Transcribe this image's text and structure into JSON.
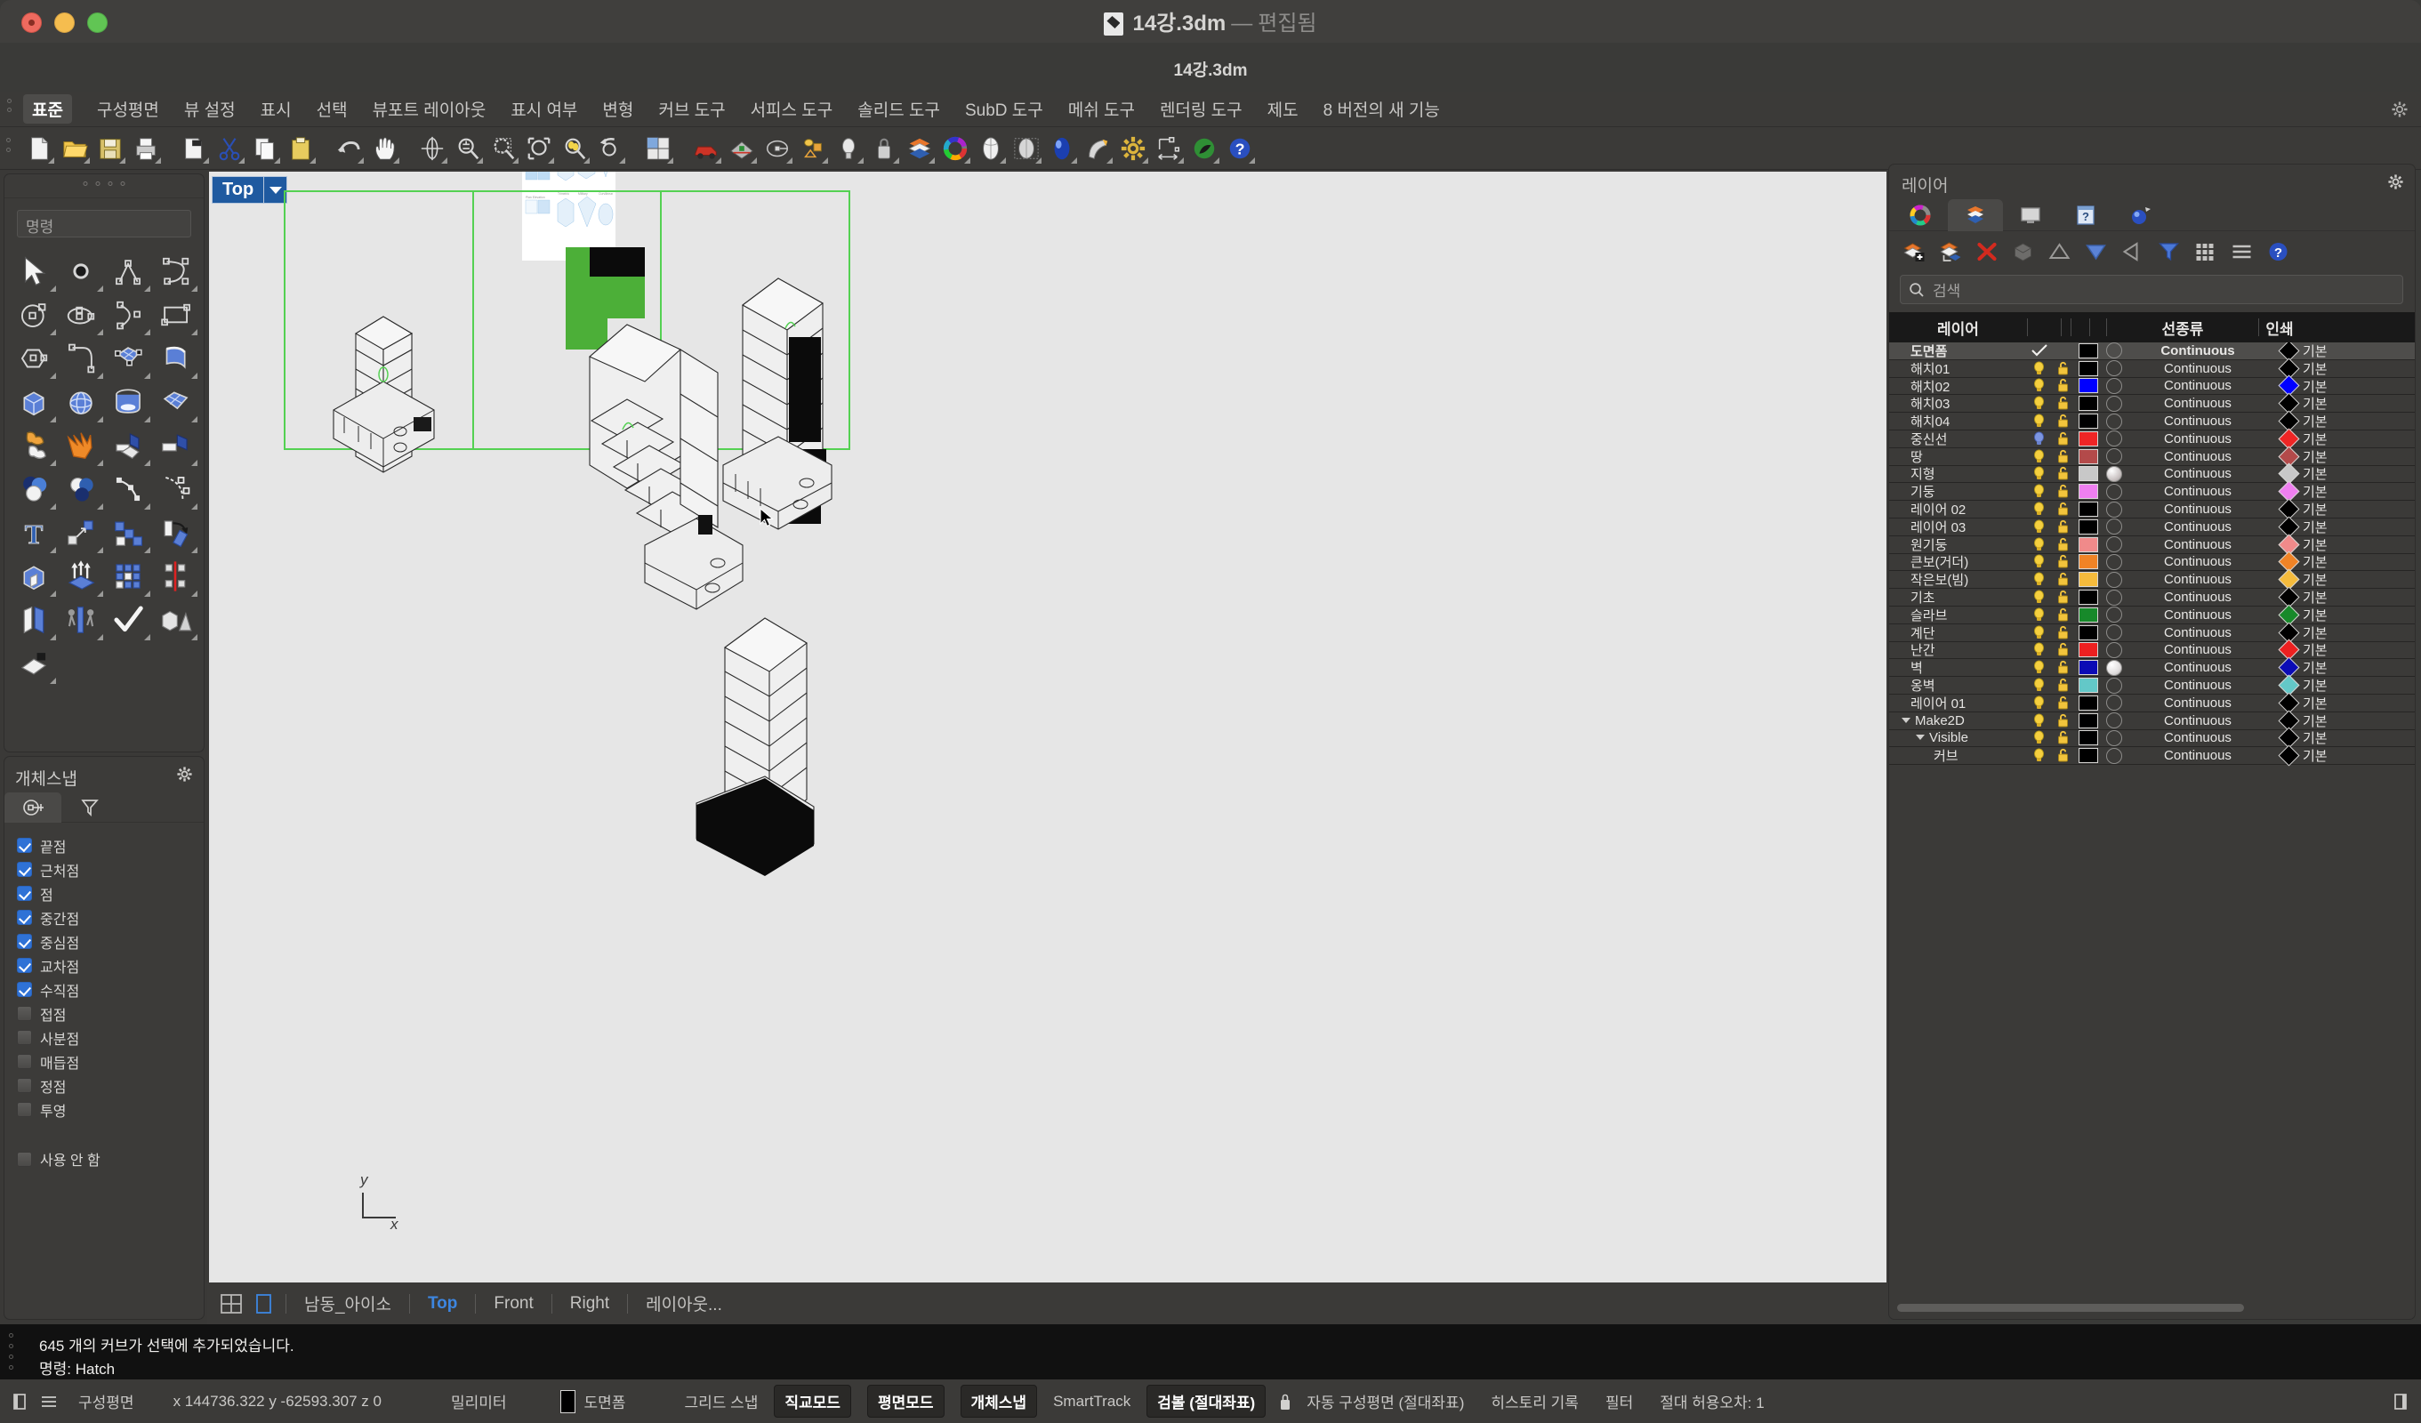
{
  "window": {
    "title": "14강.3dm",
    "title_dash": "—",
    "title_state": "편집됨",
    "subtitle": "14강.3dm",
    "doc_icon": "rhino-document-icon"
  },
  "menubar": {
    "items": [
      {
        "label": "표준",
        "active": true
      },
      {
        "label": "구성평면",
        "active": false
      },
      {
        "label": "뷰 설정",
        "active": false
      },
      {
        "label": "표시",
        "active": false
      },
      {
        "label": "선택",
        "active": false
      },
      {
        "label": "뷰포트 레이아웃",
        "active": false
      },
      {
        "label": "표시 여부",
        "active": false
      },
      {
        "label": "변형",
        "active": false
      },
      {
        "label": "커브 도구",
        "active": false
      },
      {
        "label": "서피스 도구",
        "active": false
      },
      {
        "label": "솔리드 도구",
        "active": false
      },
      {
        "label": "SubD 도구",
        "active": false
      },
      {
        "label": "메쉬 도구",
        "active": false
      },
      {
        "label": "렌더링 도구",
        "active": false
      },
      {
        "label": "제도",
        "active": false
      },
      {
        "label": "8 버전의 새 기능",
        "active": false
      }
    ],
    "settings_icon": "gear-icon"
  },
  "toolbar": {
    "buttons": [
      {
        "name": "new-file-icon"
      },
      {
        "name": "open-file-icon"
      },
      {
        "name": "save-file-icon"
      },
      {
        "name": "print-icon"
      },
      {
        "name": "copy-to-clipboard-icon"
      },
      {
        "name": "cut-icon"
      },
      {
        "name": "copy-icon"
      },
      {
        "name": "paste-icon"
      },
      {
        "name": "undo-icon"
      },
      {
        "name": "pan-icon"
      },
      {
        "name": "rotate-view-icon"
      },
      {
        "name": "zoom-icon"
      },
      {
        "name": "zoom-window-icon"
      },
      {
        "name": "zoom-extents-icon"
      },
      {
        "name": "zoom-selected-icon"
      },
      {
        "name": "undo-view-icon"
      },
      {
        "name": "four-viewport-icon"
      },
      {
        "name": "car-render-icon"
      },
      {
        "name": "grid-icon"
      },
      {
        "name": "point-object-icon"
      },
      {
        "name": "layer-state-icon"
      },
      {
        "name": "light-bulb-icon"
      },
      {
        "name": "lock-icon"
      },
      {
        "name": "layer-icon"
      },
      {
        "name": "color-wheel-icon"
      },
      {
        "name": "shaded-view-icon"
      },
      {
        "name": "ghosted-view-icon"
      },
      {
        "name": "render-preview-icon"
      },
      {
        "name": "spotlight-icon"
      },
      {
        "name": "options-gear-icon"
      },
      {
        "name": "dimension-icon"
      },
      {
        "name": "render-icon"
      },
      {
        "name": "help-icon"
      }
    ]
  },
  "left_panel": {
    "command_placeholder": "명령",
    "tools": [
      {
        "name": "select-arrow-icon"
      },
      {
        "name": "point-icon"
      },
      {
        "name": "polyline-icon"
      },
      {
        "name": "curve-icon"
      },
      {
        "name": "circle-icon"
      },
      {
        "name": "ellipse-icon"
      },
      {
        "name": "arc-icon"
      },
      {
        "name": "rectangle-icon"
      },
      {
        "name": "polygon-icon"
      },
      {
        "name": "fillet-curve-icon"
      },
      {
        "name": "surface-from-curves-icon"
      },
      {
        "name": "extrude-surface-icon"
      },
      {
        "name": "box-icon"
      },
      {
        "name": "sphere-icon"
      },
      {
        "name": "cylinder-icon"
      },
      {
        "name": "surface-patch-icon"
      },
      {
        "name": "boolean-union-icon"
      },
      {
        "name": "explode-icon"
      },
      {
        "name": "fillet-edge-icon"
      },
      {
        "name": "chamfer-edge-icon"
      },
      {
        "name": "boolean-difference-icon"
      },
      {
        "name": "boolean-split-icon"
      },
      {
        "name": "rebuild-curve-icon"
      },
      {
        "name": "curve-points-icon"
      },
      {
        "name": "text-icon"
      },
      {
        "name": "move-icon"
      },
      {
        "name": "copy-objects-icon"
      },
      {
        "name": "rotate-icon"
      },
      {
        "name": "cap-solid-icon"
      },
      {
        "name": "extrude-icon"
      },
      {
        "name": "array-icon"
      },
      {
        "name": "mirror-icon"
      },
      {
        "name": "split-icon"
      },
      {
        "name": "scale-icon"
      },
      {
        "name": "check-object-icon"
      },
      {
        "name": "group-objects-icon"
      },
      {
        "name": "cplane-icon"
      }
    ]
  },
  "osnap": {
    "title": "개체스냅",
    "gear_icon": "gear-icon",
    "tabs": [
      {
        "name": "osnap-tab-icon",
        "selected": true
      },
      {
        "name": "filter-tab-icon",
        "selected": false
      }
    ],
    "items": [
      {
        "label": "끝점",
        "checked": true
      },
      {
        "label": "근처점",
        "checked": true
      },
      {
        "label": "점",
        "checked": true
      },
      {
        "label": "중간점",
        "checked": true
      },
      {
        "label": "중심점",
        "checked": true
      },
      {
        "label": "교차점",
        "checked": true
      },
      {
        "label": "수직점",
        "checked": true
      },
      {
        "label": "접점",
        "checked": false
      },
      {
        "label": "사분점",
        "checked": false
      },
      {
        "label": "매듭점",
        "checked": false
      },
      {
        "label": "정점",
        "checked": false
      },
      {
        "label": "투영",
        "checked": false
      }
    ],
    "disable": {
      "label": "사용 안 함",
      "checked": false
    }
  },
  "viewport": {
    "label": "Top",
    "dropdown_icon": "chevron-down-icon",
    "axis_x": "x",
    "axis_y": "y",
    "tabs": [
      {
        "label": "남동_아이소",
        "active": false
      },
      {
        "label": "Top",
        "active": true
      },
      {
        "label": "Front",
        "active": false
      },
      {
        "label": "Right",
        "active": false
      },
      {
        "label": "레이아웃...",
        "active": false
      }
    ],
    "tab_icons": [
      {
        "name": "four-view-layout-icon"
      },
      {
        "name": "single-view-layout-icon"
      }
    ]
  },
  "layers_panel": {
    "title": "레이어",
    "gear_icon": "gear-icon",
    "tabs": [
      {
        "name": "properties-tab-icon",
        "selected": false
      },
      {
        "name": "layers-tab-icon",
        "selected": true
      },
      {
        "name": "display-tab-icon",
        "selected": false
      },
      {
        "name": "help-tab-icon",
        "selected": false
      },
      {
        "name": "render-tab-icon",
        "selected": false
      }
    ],
    "tools": [
      {
        "name": "new-layer-icon"
      },
      {
        "name": "new-sublayer-icon"
      },
      {
        "name": "delete-layer-icon"
      },
      {
        "name": "select-objects-icon"
      },
      {
        "name": "move-up-icon"
      },
      {
        "name": "move-down-icon"
      },
      {
        "name": "move-left-icon"
      },
      {
        "name": "filter-icon"
      },
      {
        "name": "grid-view-icon"
      },
      {
        "name": "list-view-icon"
      },
      {
        "name": "help-icon"
      }
    ],
    "search_placeholder": "검색",
    "columns": {
      "name": "레이어",
      "linetype": "선종류",
      "print": "인쇄"
    },
    "default_linetype": "Continuous",
    "default_print": "기본",
    "rows": [
      {
        "name": "도면폼",
        "indent": 0,
        "current": true,
        "visible": true,
        "locked": false,
        "color": "#000000",
        "material": "none",
        "linetype": "Continuous",
        "print": "기본",
        "print_color": "#000000"
      },
      {
        "name": "해치01",
        "indent": 0,
        "current": false,
        "visible": true,
        "locked": false,
        "color": "#000000",
        "material": "none",
        "linetype": "Continuous",
        "print": "기본",
        "print_color": "#000000"
      },
      {
        "name": "해치02",
        "indent": 0,
        "current": false,
        "visible": true,
        "locked": false,
        "color": "#0000ff",
        "material": "none",
        "linetype": "Continuous",
        "print": "기본",
        "print_color": "#0000ff"
      },
      {
        "name": "해치03",
        "indent": 0,
        "current": false,
        "visible": true,
        "locked": false,
        "color": "#000000",
        "material": "none",
        "linetype": "Continuous",
        "print": "기본",
        "print_color": "#000000"
      },
      {
        "name": "해치04",
        "indent": 0,
        "current": false,
        "visible": true,
        "locked": false,
        "color": "#000000",
        "material": "none",
        "linetype": "Continuous",
        "print": "기본",
        "print_color": "#000000"
      },
      {
        "name": "중신선",
        "indent": 0,
        "current": false,
        "visible": true,
        "locked": false,
        "color": "#ef2525",
        "material": "none",
        "linetype": "Continuous",
        "print": "기본",
        "print_color": "#ef2525",
        "bulb": "blue"
      },
      {
        "name": "땅",
        "indent": 0,
        "current": false,
        "visible": true,
        "locked": false,
        "color": "#b34a4a",
        "material": "none",
        "linetype": "Continuous",
        "print": "기본",
        "print_color": "#b34a4a"
      },
      {
        "name": "지형",
        "indent": 0,
        "current": false,
        "visible": true,
        "locked": false,
        "color": "#c8c8c8",
        "material": "filled",
        "linetype": "Continuous",
        "print": "기본",
        "print_color": "#c8c8c8"
      },
      {
        "name": "기둥",
        "indent": 0,
        "current": false,
        "visible": true,
        "locked": false,
        "color": "#ef7ff0",
        "material": "none",
        "linetype": "Continuous",
        "print": "기본",
        "print_color": "#ef7ff0"
      },
      {
        "name": "레이어 02",
        "indent": 0,
        "current": false,
        "visible": true,
        "locked": false,
        "color": "#000000",
        "material": "none",
        "linetype": "Continuous",
        "print": "기본",
        "print_color": "#000000"
      },
      {
        "name": "레이어 03",
        "indent": 0,
        "current": false,
        "visible": true,
        "locked": false,
        "color": "#000000",
        "material": "none",
        "linetype": "Continuous",
        "print": "기본",
        "print_color": "#000000"
      },
      {
        "name": "원기둥",
        "indent": 0,
        "current": false,
        "visible": true,
        "locked": false,
        "color": "#f08a8a",
        "material": "none",
        "linetype": "Continuous",
        "print": "기본",
        "print_color": "#f08a8a"
      },
      {
        "name": "큰보(거더)",
        "indent": 0,
        "current": false,
        "visible": true,
        "locked": false,
        "color": "#f08326",
        "material": "none",
        "linetype": "Continuous",
        "print": "기본",
        "print_color": "#f08326"
      },
      {
        "name": "작은보(빔)",
        "indent": 0,
        "current": false,
        "visible": true,
        "locked": false,
        "color": "#f5bb3c",
        "material": "none",
        "linetype": "Continuous",
        "print": "기본",
        "print_color": "#f5bb3c"
      },
      {
        "name": "기초",
        "indent": 0,
        "current": false,
        "visible": true,
        "locked": false,
        "color": "#000000",
        "material": "none",
        "linetype": "Continuous",
        "print": "기본",
        "print_color": "#000000"
      },
      {
        "name": "슬라브",
        "indent": 0,
        "current": false,
        "visible": true,
        "locked": false,
        "color": "#17892a",
        "material": "none",
        "linetype": "Continuous",
        "print": "기본",
        "print_color": "#17892a"
      },
      {
        "name": "계단",
        "indent": 0,
        "current": false,
        "visible": true,
        "locked": false,
        "color": "#000000",
        "material": "none",
        "linetype": "Continuous",
        "print": "기본",
        "print_color": "#000000"
      },
      {
        "name": "난간",
        "indent": 0,
        "current": false,
        "visible": true,
        "locked": false,
        "color": "#ee2020",
        "material": "none",
        "linetype": "Continuous",
        "print": "기본",
        "print_color": "#ee2020"
      },
      {
        "name": "벽",
        "indent": 0,
        "current": false,
        "visible": true,
        "locked": false,
        "color": "#0b0bb5",
        "material": "white",
        "linetype": "Continuous",
        "print": "기본",
        "print_color": "#0b0bb5"
      },
      {
        "name": "옹벽",
        "indent": 0,
        "current": false,
        "visible": true,
        "locked": false,
        "color": "#63c8c8",
        "material": "none",
        "linetype": "Continuous",
        "print": "기본",
        "print_color": "#63c8c8"
      },
      {
        "name": "레이어 01",
        "indent": 0,
        "current": false,
        "visible": true,
        "locked": false,
        "color": "#000000",
        "material": "none",
        "linetype": "Continuous",
        "print": "기본",
        "print_color": "#000000"
      },
      {
        "name": "Make2D",
        "indent": 0,
        "expander": true,
        "current": false,
        "visible": true,
        "locked": false,
        "color": "#000000",
        "material": "none",
        "linetype": "Continuous",
        "print": "기본",
        "print_color": "#000000"
      },
      {
        "name": "Visible",
        "indent": 1,
        "expander": true,
        "current": false,
        "visible": true,
        "locked": false,
        "color": "#000000",
        "material": "none",
        "linetype": "Continuous",
        "print": "기본",
        "print_color": "#000000"
      },
      {
        "name": "커브",
        "indent": 2,
        "current": false,
        "visible": true,
        "locked": false,
        "color": "#000000",
        "material": "none",
        "linetype": "Continuous",
        "print": "기본",
        "print_color": "#000000"
      }
    ]
  },
  "command_history": {
    "line1": "645 개의 커브가 선택에 추가되었습니다.",
    "line2": "명령: Hatch"
  },
  "statusbar": {
    "cplane_label": "구성평면",
    "coords": "x 144736.322  y -62593.307  z 0",
    "units": "밀리미터",
    "layer_label": "도면폼",
    "layer_color": "#000000",
    "items": [
      {
        "label": "그리드 스냅",
        "on": false
      },
      {
        "label": "직교모드",
        "on": true
      },
      {
        "label": "평면모드",
        "on": true
      },
      {
        "label": "개체스냅",
        "on": true
      },
      {
        "label": "SmartTrack",
        "on": false
      },
      {
        "label": "검볼 (절대좌표)",
        "on": true
      }
    ],
    "lock_icon": "lock-icon",
    "right_items": [
      {
        "label": "자동 구성평면 (절대좌표)"
      },
      {
        "label": "히스토리 기록"
      },
      {
        "label": "필터"
      },
      {
        "label": "절대 허용오차: 1"
      }
    ],
    "left_icons": [
      {
        "name": "panel-toggle-icon"
      },
      {
        "name": "list-icon"
      }
    ]
  },
  "colors": {
    "viewport_bg": "#e6e6e6",
    "accent_blue": "#1f5aa0",
    "selection_green": "#4caf38",
    "chrome": "#3b3a38"
  }
}
